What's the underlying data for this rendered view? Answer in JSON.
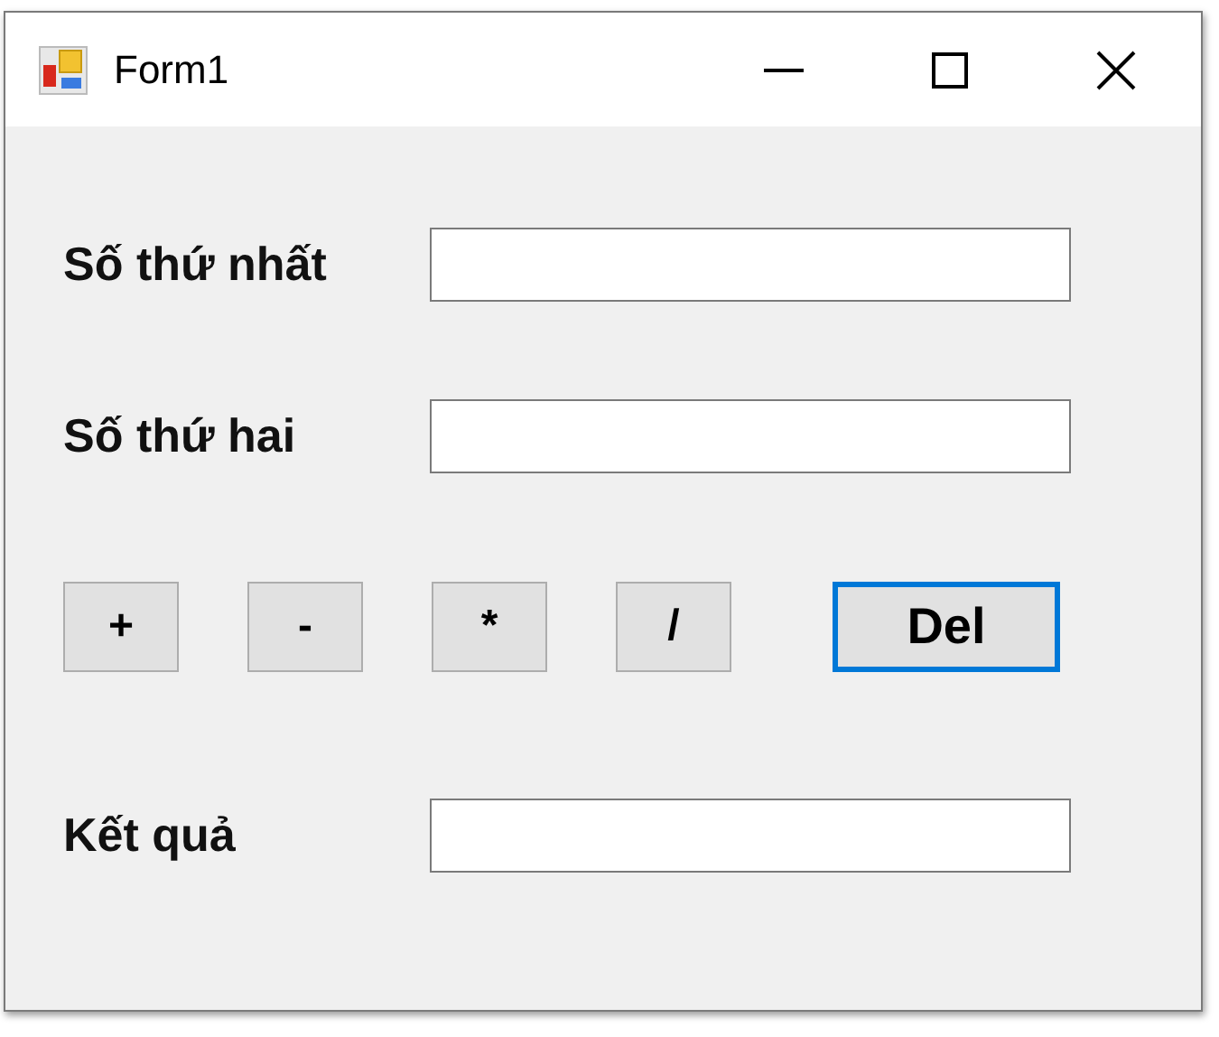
{
  "window": {
    "title": "Form1"
  },
  "fields": [
    {
      "label": "Số thứ nhất"
    },
    {
      "label": "Số thứ hai"
    }
  ],
  "buttons": [
    {
      "label": "+",
      "focused": false
    },
    {
      "label": "-",
      "focused": false
    },
    {
      "label": "*",
      "focused": false
    },
    {
      "label": "/",
      "focused": false
    },
    {
      "label": "Del",
      "focused": true
    }
  ],
  "result": {
    "label": "Kết quả"
  }
}
